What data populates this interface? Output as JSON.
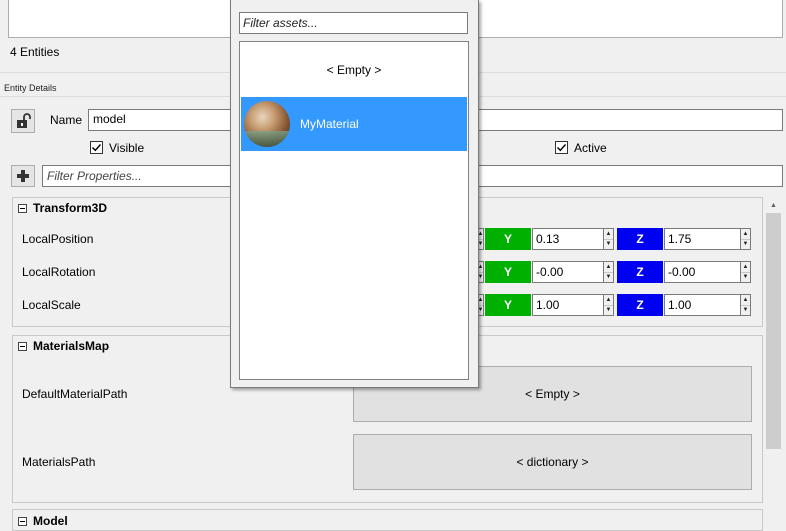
{
  "entity_list": {
    "count_text": "4 Entities"
  },
  "entity_details": {
    "title": "Entity Details",
    "name_label": "Name",
    "name_value": "model",
    "visible_label": "Visible",
    "visible_checked": true,
    "active_label": "Active",
    "active_checked": true,
    "filter_placeholder": "Filter Properties..."
  },
  "groups": {
    "transform": {
      "title": "Transform3D",
      "rows": [
        {
          "label": "LocalPosition",
          "y": "0.13",
          "z": "1.75"
        },
        {
          "label": "LocalRotation",
          "y": "-0.00",
          "z": "-0.00"
        },
        {
          "label": "LocalScale",
          "y": "1.00",
          "z": "1.00"
        }
      ],
      "axis_y": "Y",
      "axis_z": "Z"
    },
    "materials": {
      "title": "MaterialsMap",
      "default_label": "DefaultMaterialPath",
      "default_value": "< Empty >",
      "paths_label": "MaterialsPath",
      "paths_value": "< dictionary >"
    },
    "model": {
      "title": "Model"
    }
  },
  "popup": {
    "filter_placeholder": "Filter assets...",
    "empty_item": "< Empty >",
    "items": [
      {
        "label": "MyMaterial"
      }
    ]
  },
  "colors": {
    "selection": "#3399ff",
    "axis_y": "#00b000",
    "axis_z": "#0000f0"
  }
}
